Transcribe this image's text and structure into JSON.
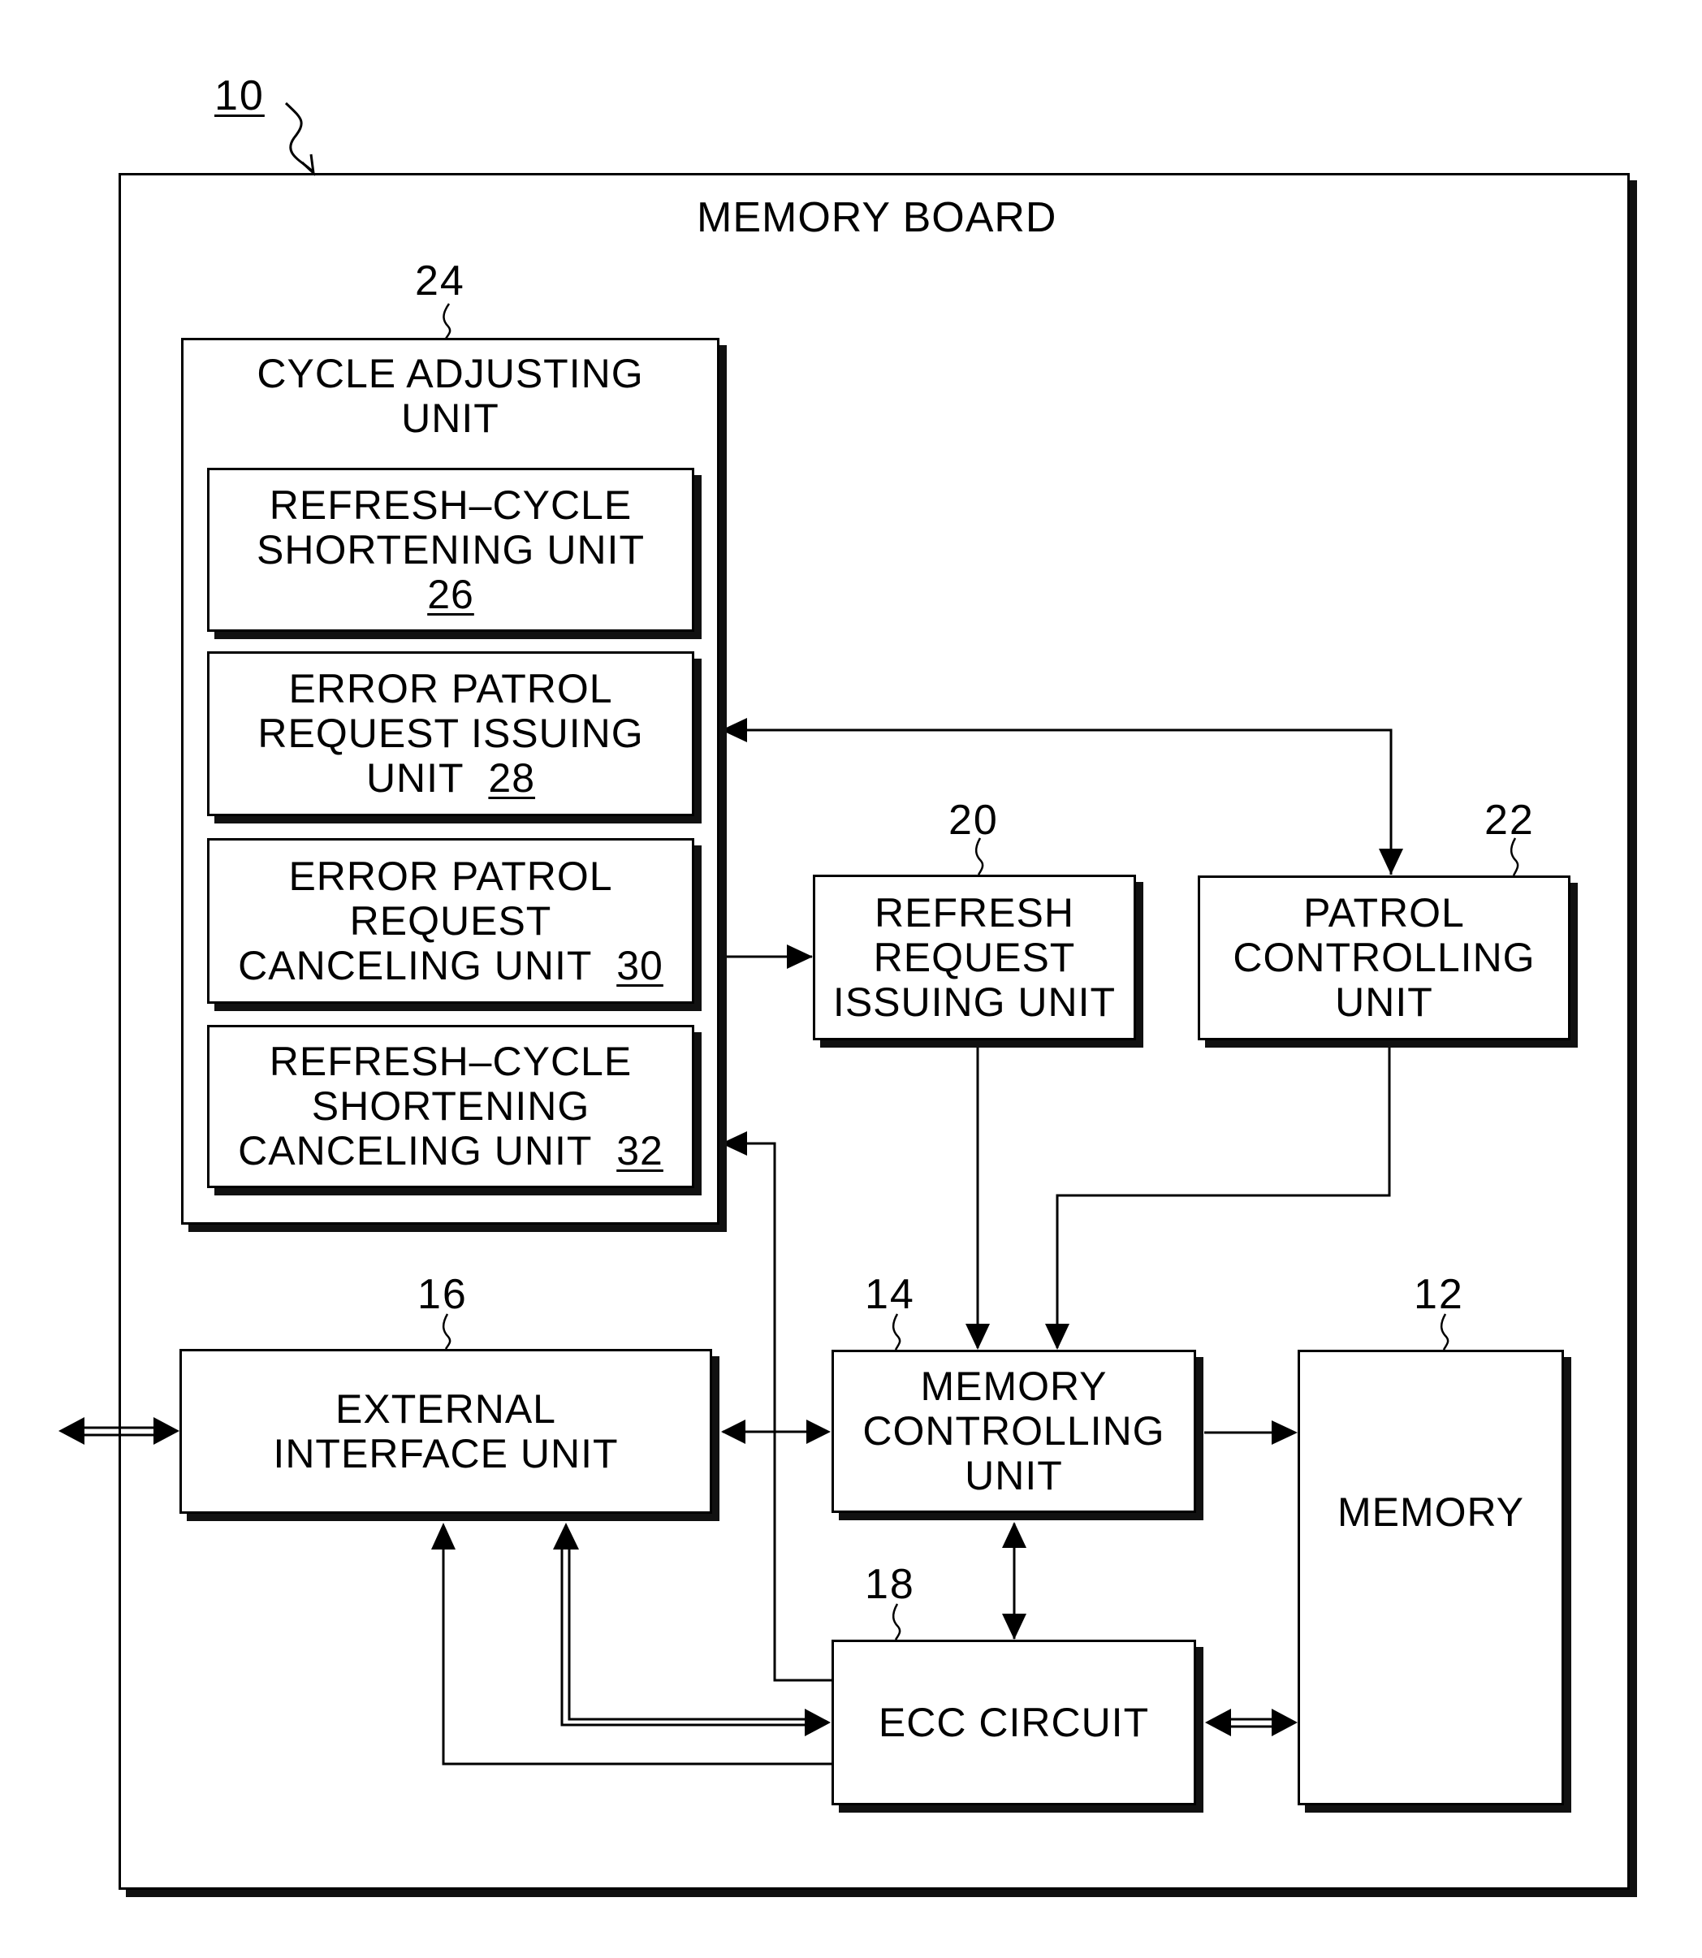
{
  "figure": {
    "ref": "10",
    "board_title": "MEMORY BOARD"
  },
  "blocks": {
    "cycle_adjusting": {
      "ref": "24",
      "lines": [
        "CYCLE ADJUSTING",
        "UNIT"
      ]
    },
    "refresh_cycle_shortening": {
      "ref": "26",
      "lines": [
        "REFRESH–CYCLE",
        "SHORTENING UNIT"
      ]
    },
    "error_patrol_issuing": {
      "ref": "28",
      "lines": [
        "ERROR PATROL",
        "REQUEST ISSUING",
        "UNIT"
      ]
    },
    "error_patrol_canceling": {
      "ref": "30",
      "lines": [
        "ERROR PATROL",
        "REQUEST",
        "CANCELING UNIT"
      ]
    },
    "refresh_shortening_canceling": {
      "ref": "32",
      "lines": [
        "REFRESH–CYCLE",
        "SHORTENING",
        "CANCELING UNIT"
      ]
    },
    "refresh_request_issuing": {
      "ref": "20",
      "lines": [
        "REFRESH",
        "REQUEST",
        "ISSUING UNIT"
      ]
    },
    "patrol_controlling": {
      "ref": "22",
      "lines": [
        "PATROL",
        "CONTROLLING",
        "UNIT"
      ]
    },
    "external_interface": {
      "ref": "16",
      "lines": [
        "EXTERNAL",
        "INTERFACE UNIT"
      ]
    },
    "memory_controlling": {
      "ref": "14",
      "lines": [
        "MEMORY",
        "CONTROLLING",
        "UNIT"
      ]
    },
    "memory": {
      "ref": "12",
      "lines": [
        "MEMORY"
      ]
    },
    "ecc_circuit": {
      "ref": "18",
      "lines": [
        "ECC CIRCUIT"
      ]
    }
  },
  "connections": [
    {
      "from": "cycle_adjusting",
      "to": "patrol_controlling",
      "type": "bidirectional"
    },
    {
      "from": "error_patrol_canceling",
      "to": "refresh_request_issuing",
      "type": "directed"
    },
    {
      "from": "ecc_circuit",
      "to": "refresh_shortening_canceling",
      "type": "directed"
    },
    {
      "from": "refresh_request_issuing",
      "to": "memory_controlling",
      "type": "directed"
    },
    {
      "from": "patrol_controlling",
      "to": "memory_controlling",
      "type": "directed"
    },
    {
      "from": "external",
      "to": "external_interface",
      "type": "bidirectional-bus"
    },
    {
      "from": "external_interface",
      "to": "memory_controlling",
      "type": "bidirectional"
    },
    {
      "from": "memory_controlling",
      "to": "memory",
      "type": "directed"
    },
    {
      "from": "memory_controlling",
      "to": "ecc_circuit",
      "type": "bidirectional"
    },
    {
      "from": "ecc_circuit",
      "to": "memory",
      "type": "bidirectional-bus"
    },
    {
      "from": "ecc_circuit",
      "to": "external_interface",
      "type": "directed"
    },
    {
      "from": "external_interface",
      "to": "ecc_circuit",
      "type": "bidirectional-bus"
    }
  ]
}
